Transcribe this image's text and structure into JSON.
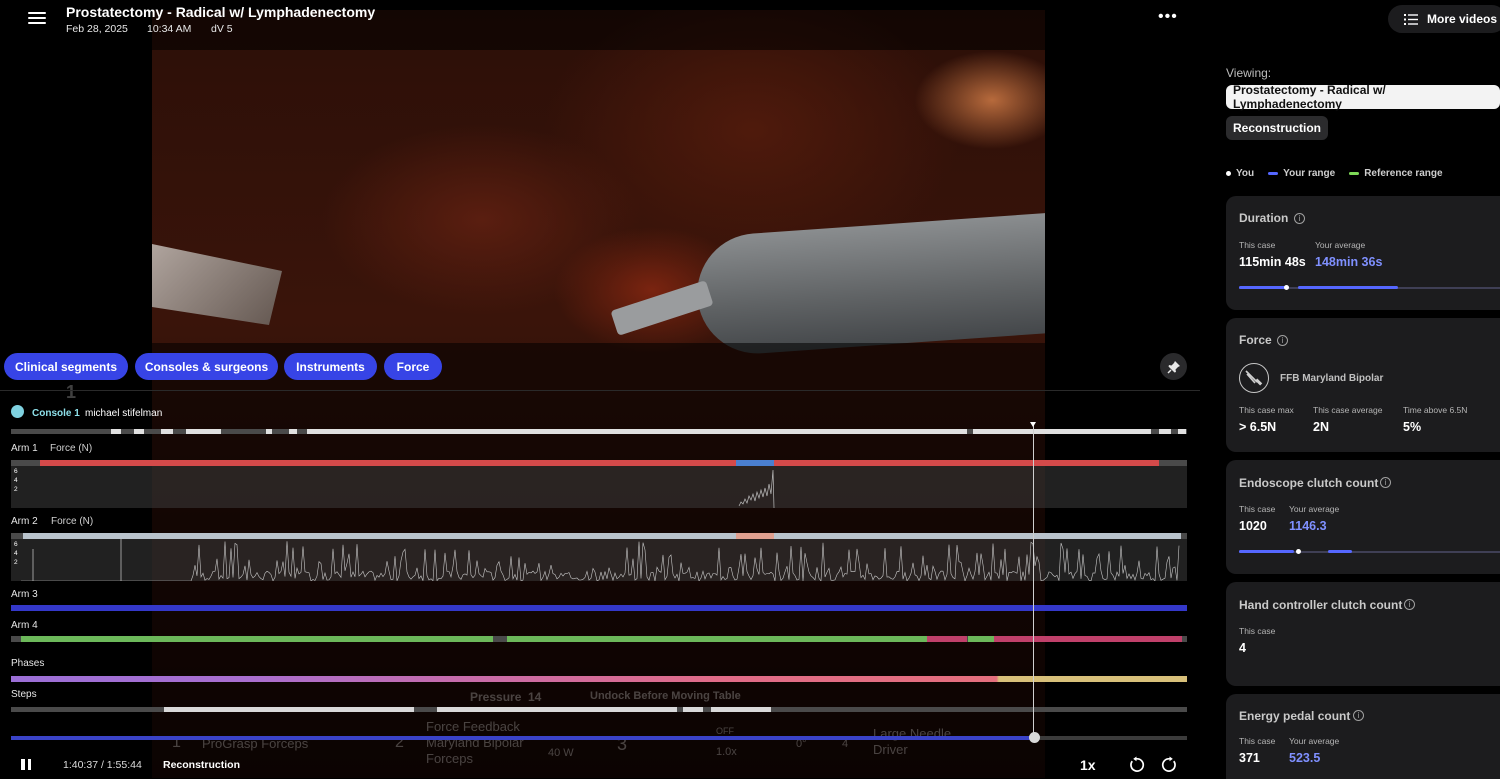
{
  "header": {
    "title": "Prostatectomy - Radical w/ Lymphadenectomy",
    "date": "Feb 28, 2025",
    "time": "10:34 AM",
    "system": "dV 5",
    "more_videos_label": "More videos"
  },
  "filters": [
    "Clinical segments",
    "Consoles & surgeons",
    "Instruments",
    "Force"
  ],
  "video_hud": {
    "pressure_label": "Pressure",
    "pressure_value": "14",
    "undock_message": "Undock Before Moving Table",
    "instrument_1": "ProGrasp Forceps",
    "instrument_2_line1": "Force Feedback",
    "instrument_2_line2": "Maryland Bipolar",
    "instrument_2_line3": "Forceps",
    "energy_watts": "40 W",
    "energy_state": "OFF",
    "zoom": "1.0x",
    "angle": "0°",
    "instrument_4_line1": "Large Needle",
    "instrument_4_line2": "Driver",
    "arm_numbers": [
      "1",
      "2",
      "3",
      "4"
    ]
  },
  "timeline": {
    "console_label": "Console 1",
    "surgeon": "michael stifelman",
    "arm1_label": "Arm 1",
    "arm2_label": "Arm 2",
    "arm3_label": "Arm 3",
    "arm4_label": "Arm 4",
    "force_label": "Force (N)",
    "phases_label": "Phases",
    "steps_label": "Steps",
    "axis_ticks": [
      "6",
      "4",
      "2"
    ],
    "progress_fraction": 0.8707
  },
  "transport": {
    "timecode": "1:40:37 / 1:55:44",
    "mode": "Reconstruction",
    "speed": "1x"
  },
  "sidebar": {
    "viewing_label": "Viewing:",
    "procedure_chip": "Prostatectomy - Radical w/ Lymphadenectomy",
    "mode_chip": "Reconstruction",
    "legend": [
      {
        "label": "You",
        "color": "#ffffff"
      },
      {
        "label": "Your range",
        "color": "#5567ff"
      },
      {
        "label": "Reference range",
        "color": "#7ed957"
      }
    ],
    "duration": {
      "title": "Duration",
      "this_case_label": "This case",
      "this_case_value": "115min 48s",
      "avg_label": "Your average",
      "avg_value": "148min 36s"
    },
    "force": {
      "title": "Force",
      "instrument": "FFB Maryland Bipolar",
      "max_label": "This case max",
      "max_value": "> 6.5N",
      "avg_label": "This case average",
      "avg_value": "2N",
      "above_label": "Time above 6.5N",
      "above_value": "5%"
    },
    "endoscope": {
      "title": "Endoscope clutch count",
      "this_case_label": "This case",
      "this_case_value": "1020",
      "avg_label": "Your average",
      "avg_value": "1146.3"
    },
    "hand_controller": {
      "title": "Hand controller clutch count",
      "this_case_label": "This case",
      "this_case_value": "4"
    },
    "energy_pedal": {
      "title": "Energy pedal count",
      "this_case_label": "This case",
      "this_case_value": "371",
      "avg_label": "Your average",
      "avg_value": "523.5"
    }
  }
}
